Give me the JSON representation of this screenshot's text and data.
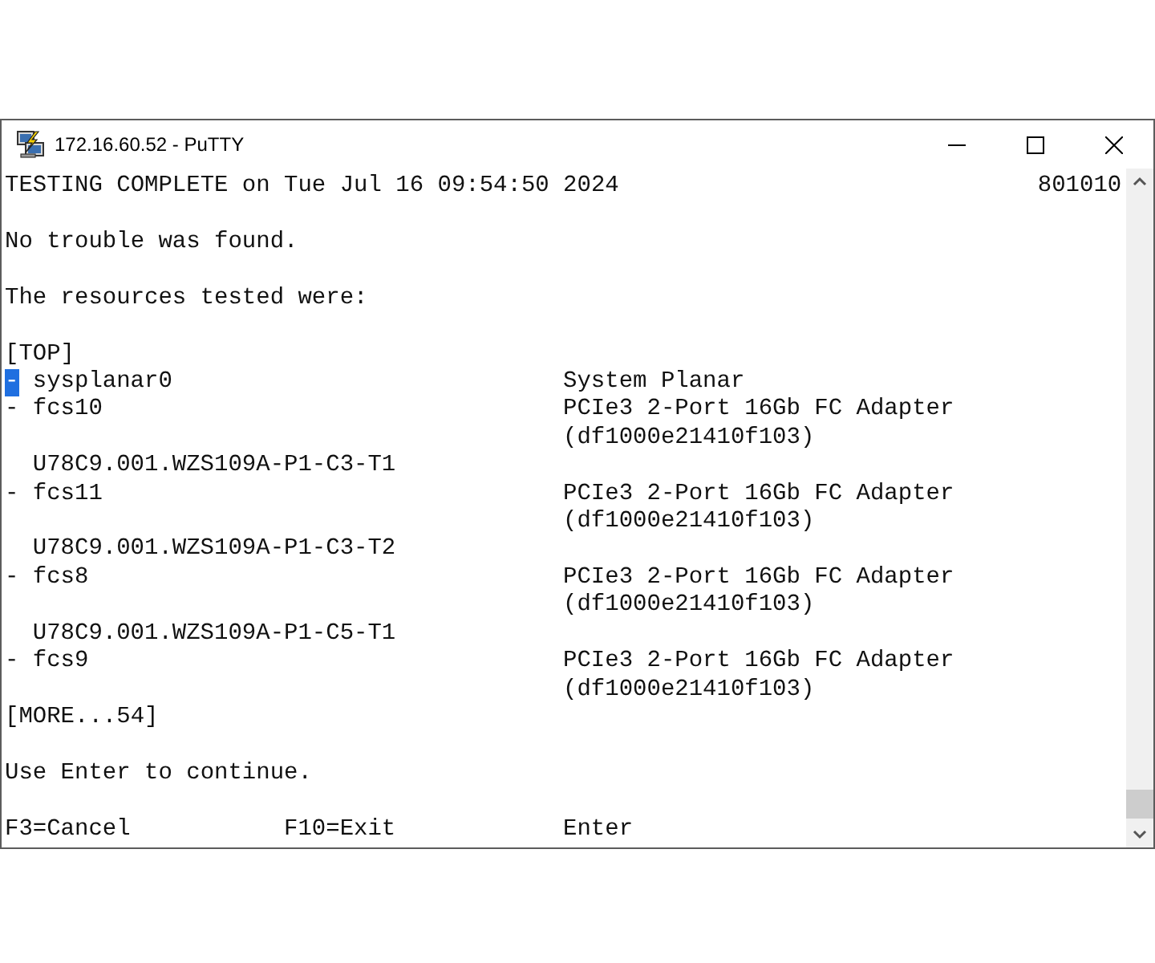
{
  "window": {
    "title": "172.16.60.52 - PuTTY"
  },
  "terminal": {
    "header": {
      "status": "TESTING COMPLETE on Tue Jul 16 09:54:50 2024",
      "code": "801010"
    },
    "messages": [
      "No trouble was found.",
      "The resources tested were:"
    ],
    "top_marker": "[TOP]",
    "resources": [
      {
        "bullet": "-",
        "name": "sysplanar0",
        "cursor": true,
        "description": [
          "System Planar"
        ]
      },
      {
        "bullet": "-",
        "name": "fcs10",
        "cursor": false,
        "description": [
          "PCIe3 2-Port 16Gb FC Adapter",
          "(df1000e21410f103)"
        ],
        "location": "U78C9.001.WZS109A-P1-C3-T1"
      },
      {
        "bullet": "-",
        "name": "fcs11",
        "cursor": false,
        "description": [
          "PCIe3 2-Port 16Gb FC Adapter",
          "(df1000e21410f103)"
        ],
        "location": "U78C9.001.WZS109A-P1-C3-T2"
      },
      {
        "bullet": "-",
        "name": "fcs8",
        "cursor": false,
        "description": [
          "PCIe3 2-Port 16Gb FC Adapter",
          "(df1000e21410f103)"
        ],
        "location": "U78C9.001.WZS109A-P1-C5-T1"
      },
      {
        "bullet": "-",
        "name": "fcs9",
        "cursor": false,
        "description": [
          "PCIe3 2-Port 16Gb FC Adapter",
          "(df1000e21410f103)"
        ]
      }
    ],
    "more_marker": "[MORE...54]",
    "prompt": "Use Enter to continue.",
    "function_keys": [
      "F3=Cancel",
      "F10=Exit",
      "Enter"
    ]
  }
}
